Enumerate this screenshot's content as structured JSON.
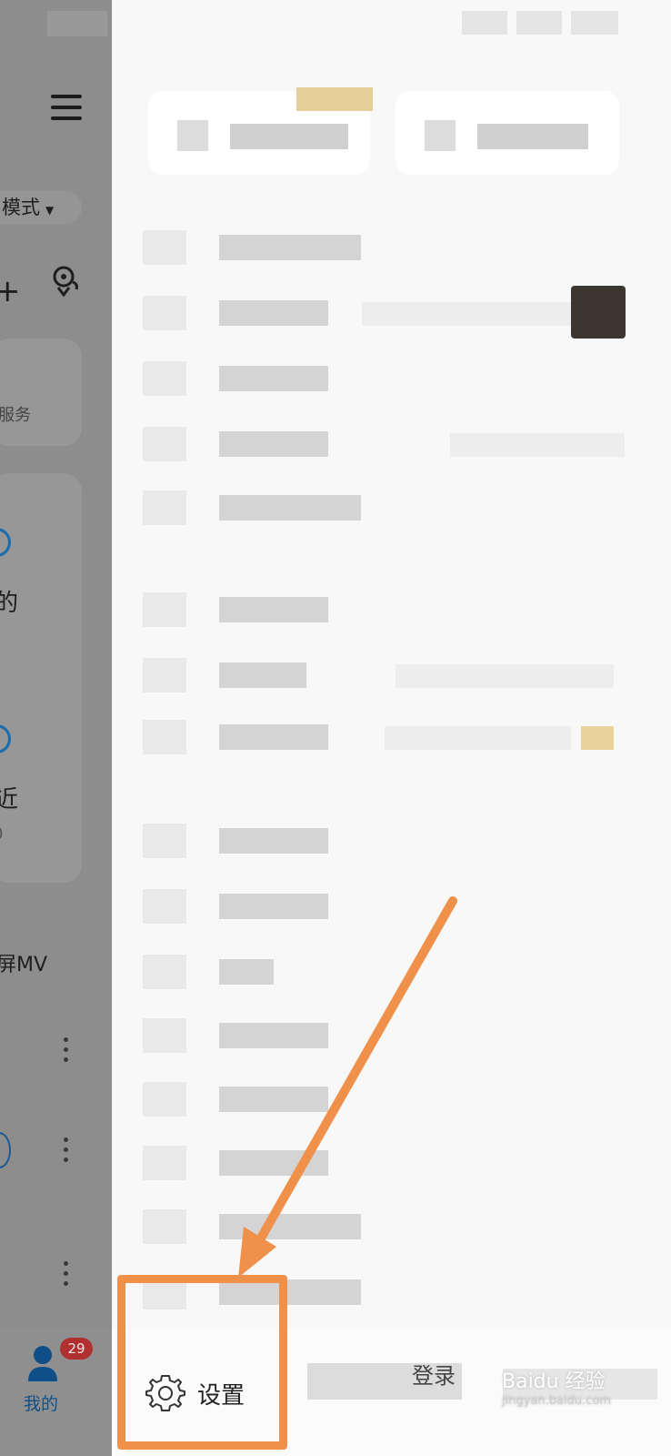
{
  "background_app": {
    "mode_label": "模式",
    "service_label": "服务",
    "card_text_1": "的",
    "card_text_2": "近",
    "card_text_3": "0",
    "full_mv_label": "屏MV",
    "bottom_nav": {
      "mine_label": "我的",
      "badge_count": "29"
    }
  },
  "drawer": {
    "settings_label": "设置",
    "partial_footer_text": "登录"
  },
  "annotation": {
    "highlight_color": "#f0914b"
  },
  "watermark": {
    "brand": "Baidu 经验",
    "url": "jingyan.baidu.com"
  }
}
